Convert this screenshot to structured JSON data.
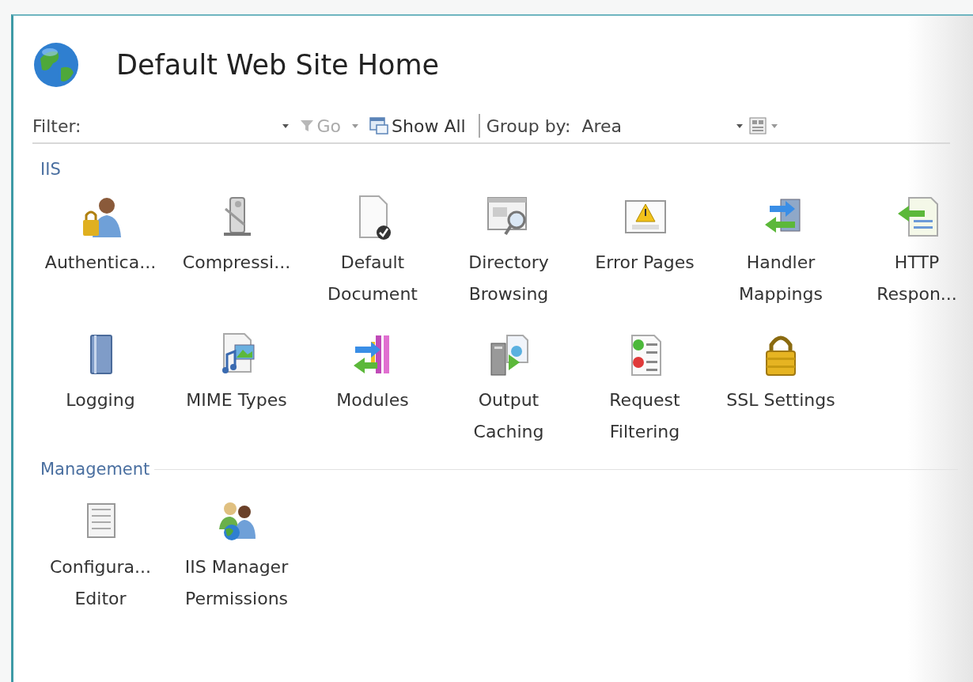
{
  "page": {
    "title": "Default Web Site Home"
  },
  "toolbar": {
    "filter_label": "Filter:",
    "go_label": "Go",
    "go_disabled": true,
    "show_all_label": "Show All",
    "group_by_label": "Group by:",
    "group_by_value": "Area"
  },
  "groups": [
    {
      "name": "IIS",
      "items": [
        {
          "label": "Authentica..."
        },
        {
          "label": "Compressi..."
        },
        {
          "label": "Default\nDocument"
        },
        {
          "label": "Directory\nBrowsing"
        },
        {
          "label": "Error Pages"
        },
        {
          "label": "Handler\nMappings"
        },
        {
          "label": "HTTP\nRespon..."
        },
        {
          "label": "Logging"
        },
        {
          "label": "MIME Types"
        },
        {
          "label": "Modules"
        },
        {
          "label": "Output\nCaching"
        },
        {
          "label": "Request\nFiltering"
        },
        {
          "label": "SSL Settings"
        }
      ]
    },
    {
      "name": "Management",
      "items": [
        {
          "label": "Configura...\nEditor"
        },
        {
          "label": "IIS Manager\nPermissions"
        }
      ]
    }
  ]
}
